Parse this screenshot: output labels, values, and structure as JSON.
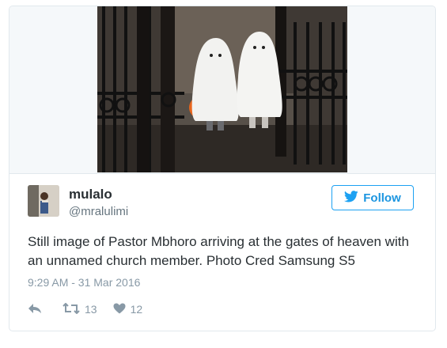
{
  "tweet": {
    "display_name": "mulalo",
    "handle": "@mralulimi",
    "follow_label": "Follow",
    "text": "Still image of Pastor Mbhoro arriving at the gates of heaven with an unnamed church member. Photo Cred Samsung S5",
    "timestamp": "9:29 AM - 31 Mar 2016",
    "retweet_count": "13",
    "like_count": "12"
  },
  "icons": {
    "follow": "twitter-bird-icon",
    "reply": "reply-icon",
    "retweet": "retweet-icon",
    "like": "heart-icon"
  },
  "colors": {
    "accent": "#1da1f2",
    "text": "#292f33",
    "muted": "#8899a6",
    "border": "#e1e8ed"
  }
}
